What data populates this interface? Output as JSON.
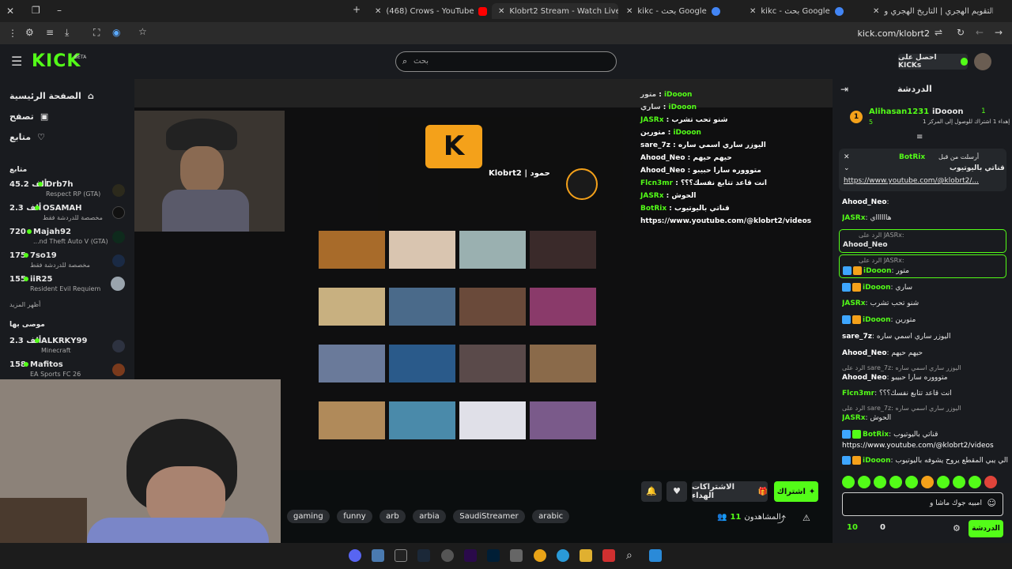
{
  "browser": {
    "tabs": [
      {
        "label": "(468) Crows - YouTube"
      },
      {
        "label": "Klobrt2 Stream - Watch Live"
      },
      {
        "label": "kikc - بحث Google"
      },
      {
        "label": "kikc - بحث Google"
      },
      {
        "label": "التقويم الهجري | التاريخ الهجري و..."
      }
    ],
    "url": "kick.com/klobrt2"
  },
  "header": {
    "logo": "KICK",
    "logo_badge": "BETA",
    "search_placeholder": "بحث",
    "get_kicks_label": "احصل على KICKs"
  },
  "sidebar": {
    "nav": [
      {
        "label": "الصفحة الرئيسية",
        "icon": "home-icon"
      },
      {
        "label": "تصفح",
        "icon": "browse-icon"
      },
      {
        "label": "متابع",
        "icon": "heart-icon"
      }
    ],
    "following_title": "متابع",
    "following": [
      {
        "name": "Drb7h",
        "count": "45.2 ألف",
        "category": "Respect RP (GTA)"
      },
      {
        "name": "OSAMAH",
        "count": "2.3 ألف",
        "category": "مخصصة للدردشة فقط"
      },
      {
        "name": "Majah92",
        "count": "720",
        "category": "...nd Theft Auto V (GTA)"
      },
      {
        "name": "7so19",
        "count": "175",
        "category": "مخصصة للدردشة فقط"
      },
      {
        "name": "iiR25",
        "count": "155",
        "category": "Resident Evil Requiem"
      }
    ],
    "show_more": "أظهر المزيد",
    "recommended_title": "موصى بها",
    "recommended": [
      {
        "name": "ALKRKY99",
        "count": "2.3 ألف",
        "category": "Minecraft"
      },
      {
        "name": "Mafitos",
        "count": "158",
        "category": "EA Sports FC 26"
      }
    ]
  },
  "stream": {
    "channel_name": "Klobrt2 | حمود",
    "overlay_chat": [
      {
        "user": "iDooon",
        "text": "متور"
      },
      {
        "user": "iDooon",
        "text": "ساري"
      },
      {
        "user": "JASRx",
        "text": "شنو تحب تشرب"
      },
      {
        "user": "iDooon",
        "text": "متورين"
      },
      {
        "user": "sare_7z",
        "text": "اليوزر ساري اسمي ساره"
      },
      {
        "user": "Ahood_Neo",
        "text": "حيهم حيهم"
      },
      {
        "user": "Ahood_Neo",
        "text": "متوووره سارا حبيبو"
      },
      {
        "user": "Flcn3mr",
        "text": "انت قاعد تتابع نفسك؟؟؟"
      },
      {
        "user": "JASRx",
        "text": "الحوش"
      },
      {
        "user": "BotRix",
        "text": "قناتي باليوتيوب"
      },
      {
        "user": "",
        "text": "https://www.youtube.com/@klobrt2/videos"
      }
    ]
  },
  "info": {
    "subscribe_label": "اشتراك",
    "gift_label": "الاشتراكات الهداء",
    "viewers_label": "المشاهدون",
    "viewers_count": "11",
    "tags": [
      "gaming",
      "funny",
      "arb",
      "arbia",
      "SaudiStreamer",
      "arabic"
    ]
  },
  "chat": {
    "title": "الدردشة",
    "leaderboard": [
      {
        "rank": "1",
        "name": "iDooon",
        "sub": "إهداء 1 اشتراك للوصول إلى المركز 1"
      },
      {
        "rank": "5",
        "name": "Alihasan1231",
        "sub": ""
      }
    ],
    "pinned_by": "أرسلت من قبل",
    "pinned_user": "BotRix",
    "pinned_text": "قناتي باليوتيوب",
    "pinned_link": "https://www.youtube.com/@klobrt2/...",
    "messages": [
      {
        "user": "Ahood_Neo",
        "text": "",
        "color": "#ffffff"
      },
      {
        "user": "JASRx",
        "text": "هااااااي",
        "color": "#53fc18"
      },
      {
        "reply": "الرد على JASRx:",
        "user": "Ahood_Neo",
        "text": "",
        "color": "#ffffff"
      },
      {
        "reply": "الرد على JASRx:",
        "user": "iDooon",
        "text": "متور",
        "color": "#53fc18"
      },
      {
        "user": "iDooon",
        "text": "ساري",
        "color": "#53fc18"
      },
      {
        "user": "JASRx",
        "text": "شنو تحب تشرب",
        "color": "#53fc18"
      },
      {
        "user": "iDooon",
        "text": "متورين",
        "color": "#53fc18"
      },
      {
        "user": "sare_7z",
        "text": "اليوزر ساري اسمي ساره",
        "color": "#ffffff"
      },
      {
        "user": "Ahood_Neo",
        "text": "حيهم حيهم",
        "color": "#ffffff"
      },
      {
        "reply": "الرد على sare_7z: اليوزر ساري اسمي ساره",
        "user": "Ahood_Neo",
        "text": "متوووره سارا حبيبو",
        "color": "#ffffff"
      },
      {
        "user": "Flcn3mr",
        "text": "انت قاعد تتابع نفسك؟؟؟",
        "color": "#53fc18"
      },
      {
        "reply": "الرد على sare_7z: اليوزر ساري اسمي ساره",
        "user": "JASRx",
        "text": "الحوش",
        "color": "#53fc18"
      },
      {
        "user": "BotRix",
        "text": "قناتي باليوتيوب",
        "color": "#53fc18"
      },
      {
        "user": "",
        "text": "https://www.youtube.com/@klobrt2/videos",
        "color": "#ffffff"
      },
      {
        "user": "iDooon",
        "text": "الي يبي المقطع يروح يشوفه باليوتيوب",
        "color": "#53fc18"
      }
    ],
    "input_value": "امبيه جوك ماشا و",
    "send_label": "الدردشة",
    "points": "0",
    "kicks": "10"
  },
  "colors": {
    "accent": "#53fc18",
    "bg": "#0b0e0f",
    "panel": "#191b1f"
  }
}
